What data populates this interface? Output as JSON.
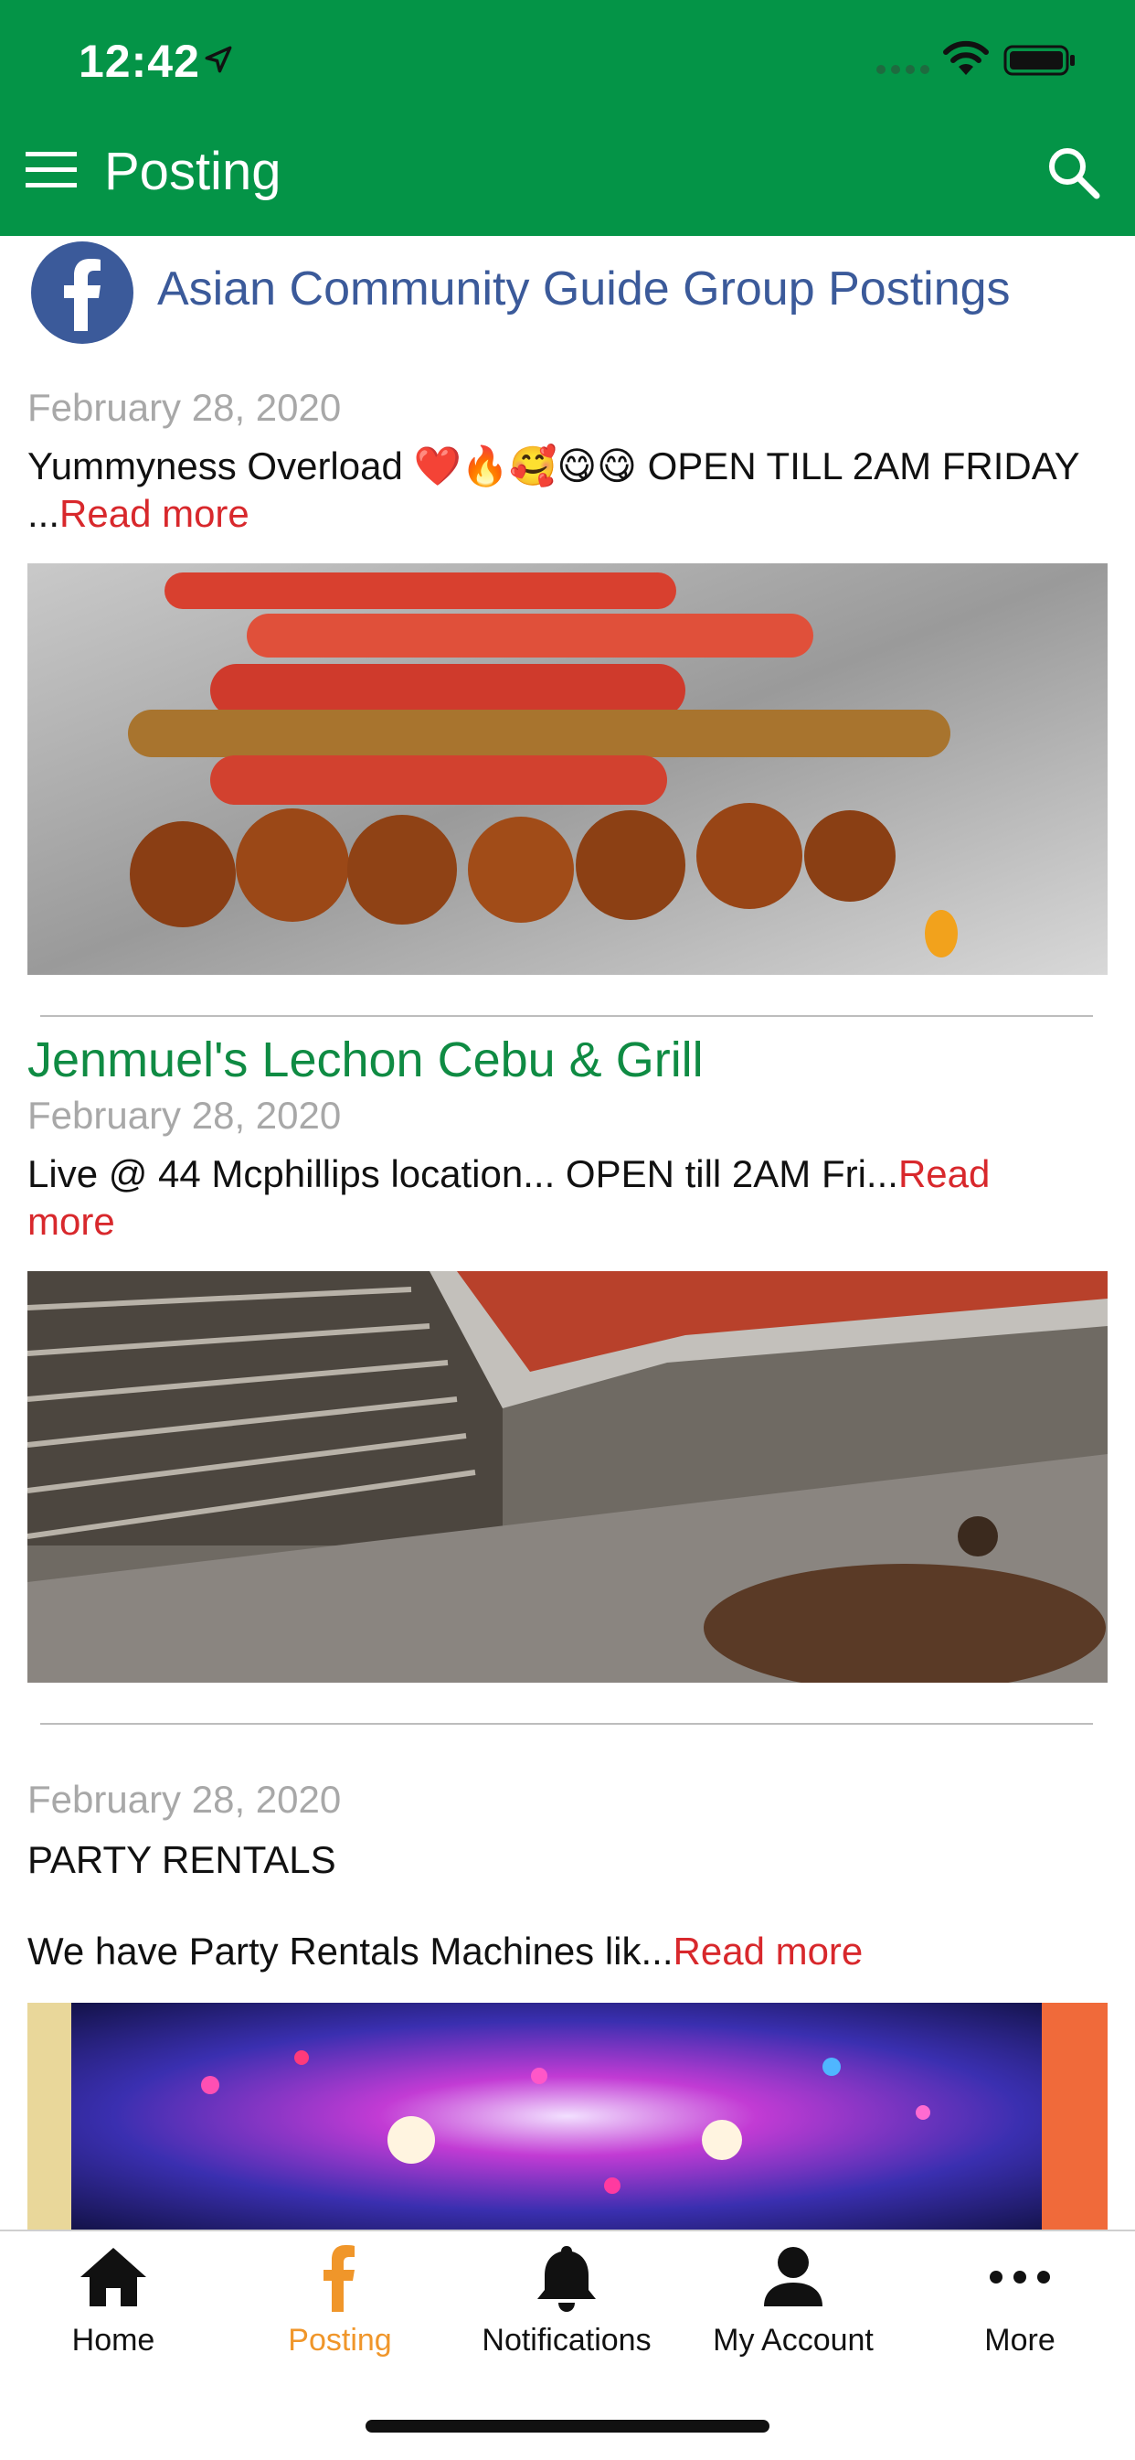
{
  "status_bar": {
    "time": "12:42"
  },
  "header": {
    "title": "Posting"
  },
  "group": {
    "name": "Asian Community Guide Group Postings"
  },
  "posts": [
    {
      "title": "",
      "date": "February 28, 2020",
      "text": "Yummyness Overload ❤️🔥🥰😋😋 OPEN TILL 2AM FRIDAY ...",
      "read_more": "Read more"
    },
    {
      "title": "Jenmuel's Lechon Cebu & Grill",
      "date": "February 28, 2020",
      "text": "Live @ 44 Mcphillips location... OPEN till 2AM Fri...",
      "read_more": "Read more"
    },
    {
      "title": "",
      "date": "February 28, 2020",
      "text_line1": "PARTY RENTALS",
      "text_line2": "We have Party Rentals Machines lik...",
      "read_more": "Read more"
    }
  ],
  "tabs": [
    {
      "label": "Home",
      "icon": "home-icon"
    },
    {
      "label": "Posting",
      "icon": "facebook-icon",
      "active": true
    },
    {
      "label": "Notifications",
      "icon": "bell-icon"
    },
    {
      "label": "My Account",
      "icon": "user-icon"
    },
    {
      "label": "More",
      "icon": "more-icon"
    }
  ],
  "colors": {
    "header_green": "#049447",
    "title_green": "#0f8b43",
    "read_more_red": "#d8282c",
    "active_tab_orange": "#f0962a",
    "facebook_blue": "#3b5a9a"
  }
}
